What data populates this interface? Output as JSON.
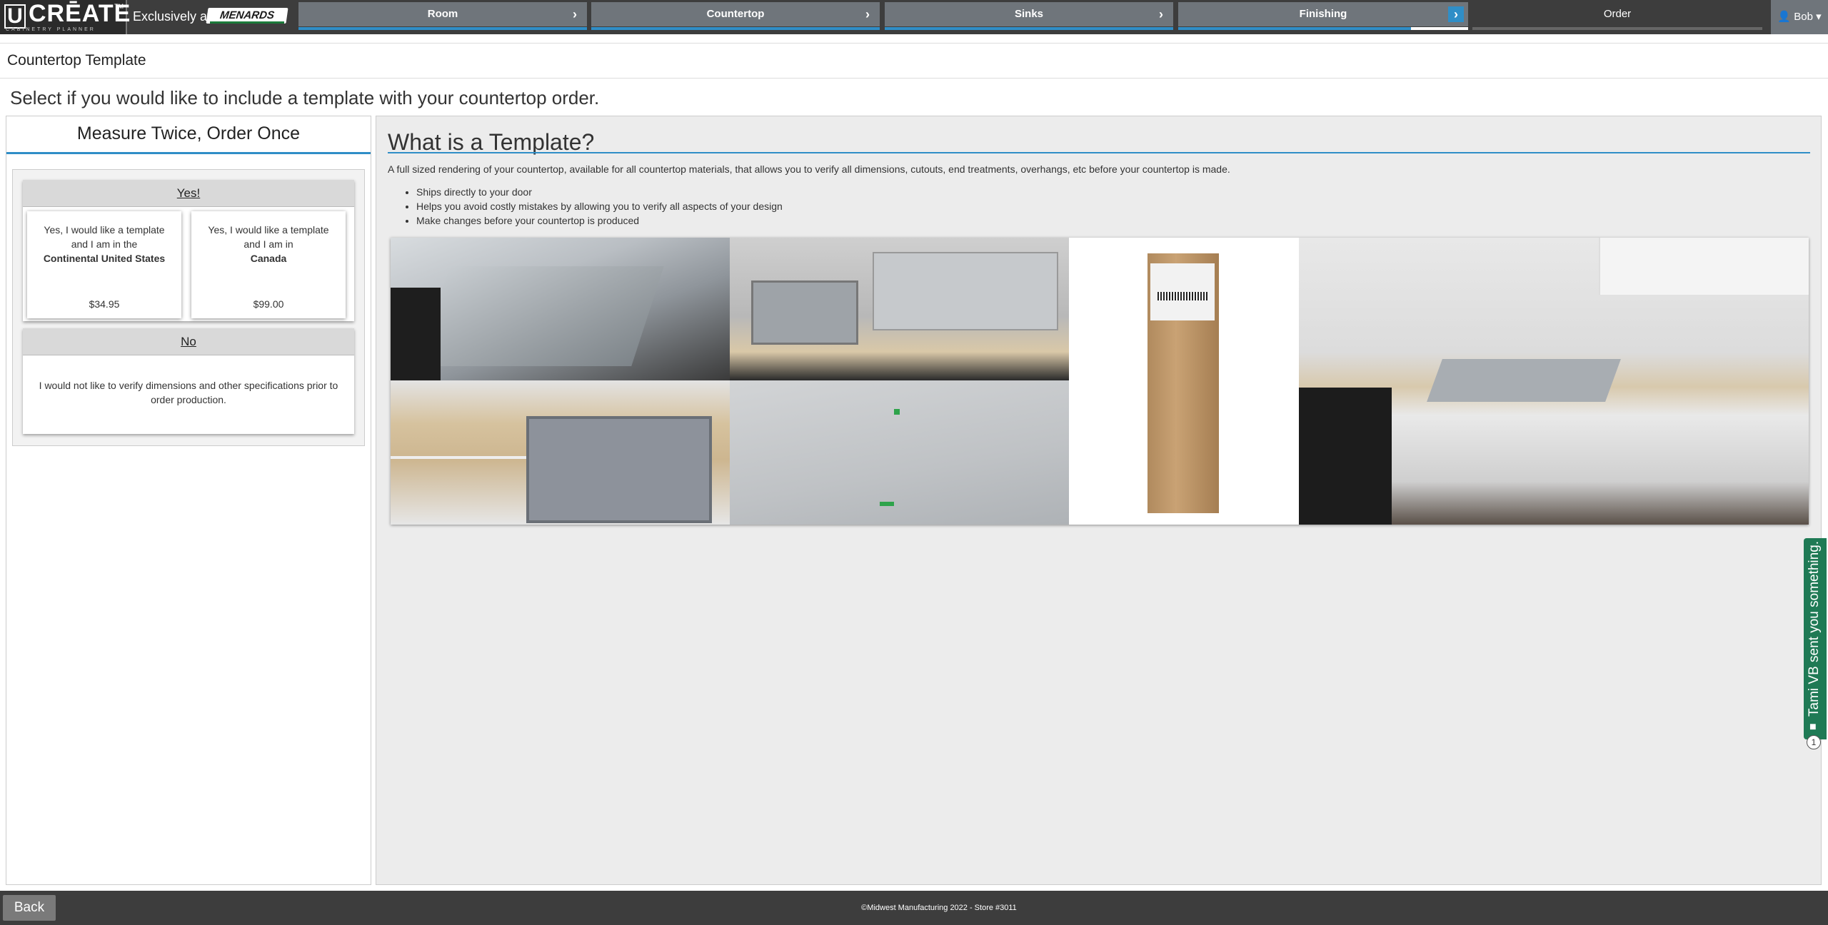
{
  "brand": {
    "logo_letter": "U",
    "logo_word": "CRĒATE",
    "logo_tm": "TM",
    "logo_sub": "CABINETRY PLANNER",
    "exclusively": "Exclusively at",
    "retailer": "MENARDS"
  },
  "steps": [
    {
      "label": "Room",
      "arrow": "›"
    },
    {
      "label": "Countertop",
      "arrow": "›"
    },
    {
      "label": "Sinks",
      "arrow": "›"
    },
    {
      "label": "Finishing",
      "arrow": "›"
    },
    {
      "label": "Order"
    }
  ],
  "user": {
    "name": "Bob",
    "caret": "▾",
    "icon": "user-icon"
  },
  "page": {
    "title": "Countertop Template",
    "instruction": "Select if you would like to include a template with your countertop order."
  },
  "left": {
    "title": "Measure Twice, Order Once",
    "yes_header": "Yes!",
    "choices": [
      {
        "line1": "Yes, I would like a template",
        "line2": "and I am in the",
        "region": "Continental United States",
        "price": "$34.95"
      },
      {
        "line1": "Yes, I would like a template",
        "line2": "and I am in",
        "region": "Canada",
        "price": "$99.00"
      }
    ],
    "no_header": "No",
    "no_text": "I would not like to verify dimensions and other specifications prior to order production."
  },
  "right": {
    "title": "What is a Template?",
    "description": "A full sized rendering of your countertop, available for all countertop materials, that allows you to verify all dimensions, cutouts, end treatments, overhangs, etc before your countertop is made.",
    "bullets": [
      "Ships directly to your door",
      "Helps you avoid costly mistakes by allowing you to verify all aspects of your design",
      "Make changes before your countertop is produced"
    ]
  },
  "footer": {
    "back": "Back",
    "copyright": "©Midwest Manufacturing 2022 - Store #3011"
  },
  "chat": {
    "text": "Tami VB sent you something.",
    "badge": "1"
  },
  "colors": {
    "accent": "#2f8ec7",
    "nav": "#3d3d3d",
    "step": "#6f757b",
    "chat": "#1f7a55"
  }
}
